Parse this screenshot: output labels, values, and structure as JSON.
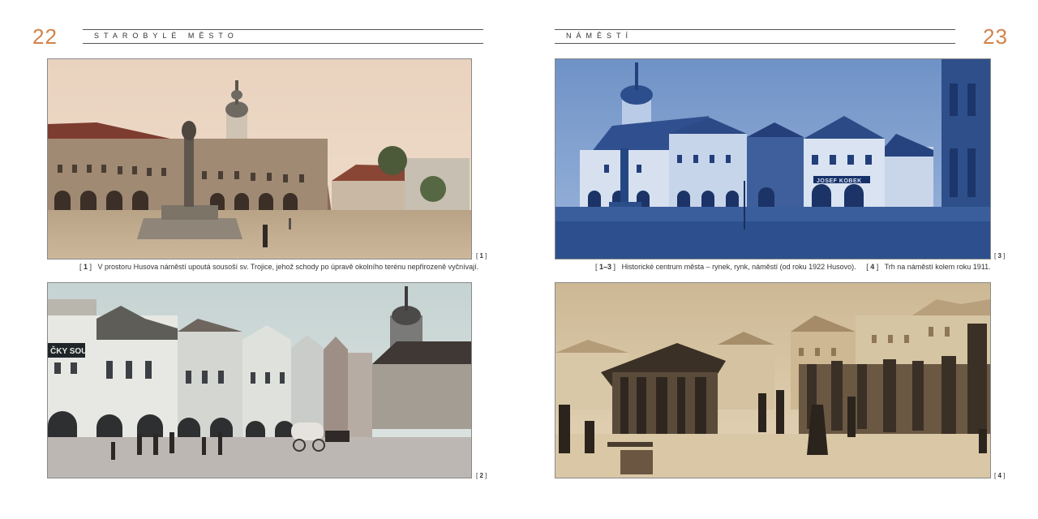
{
  "left_page": {
    "number": "22",
    "section": "STAROBYLÉ MĚSTO",
    "photo1_ref": "1",
    "photo2_ref": "2",
    "caption": {
      "ref": "1",
      "text": "V prostoru Husova náměstí upoutá sousoší sv. Trojice, jehož schody po úpravě okolního terénu nepřirozeně vyčnívají."
    }
  },
  "right_page": {
    "number": "23",
    "section": "NÁMĚSTÍ",
    "photo3_ref": "3",
    "photo4_ref": "4",
    "caption": {
      "ref_a": "1–3",
      "text_a": "Historické centrum města – rynek, rynk, náměstí (od roku 1922 Husovo).",
      "ref_b": "4",
      "text_b": "Trh na náměstí kolem roku 1911."
    },
    "shop_sign": "JOSEF KOBEK"
  },
  "photo2_sign": "ČKY SOUKUP",
  "colors": {
    "accent": "#d2834a",
    "sepia": "#c9b08a",
    "cyan": "#3f66a8"
  }
}
